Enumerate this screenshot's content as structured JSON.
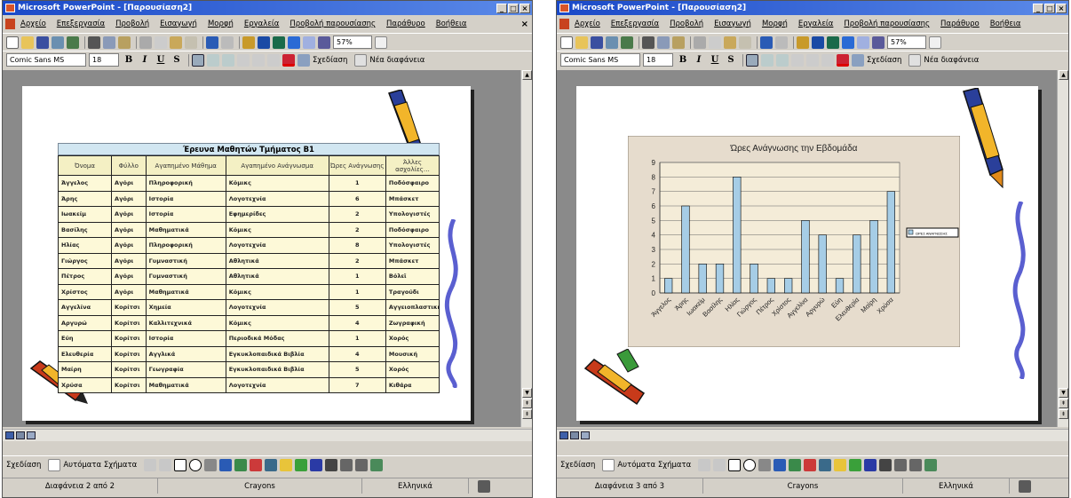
{
  "left": {
    "title": "Microsoft PowerPoint - [Παρουσίαση2]",
    "menu": [
      "Αρχείο",
      "Επεξεργασία",
      "Προβολή",
      "Εισαγωγή",
      "Μορφή",
      "Εργαλεία",
      "Προβολή παρουσίασης",
      "Παράθυρο",
      "Βοήθεια"
    ],
    "zoom": "57%",
    "font": "Comic Sans MS",
    "size": "18",
    "design": "Σχεδίαση",
    "new_slide": "Νέα διαφάνεια",
    "draw": "Σχεδίαση",
    "autoshapes": "Αυτόματα Σχήματα",
    "status_slide": "Διαφάνεια 2 από 2",
    "status_theme": "Crayons",
    "status_lang": "Ελληνικά",
    "table": {
      "title": "Έρευνα Μαθητών Τμήματος Β1",
      "headers": [
        "Όνομα",
        "Φύλλο",
        "Αγαπημένο Μάθημα",
        "Αγαπημένο Ανάγνωσμα",
        "Ώρες Ανάγνωσης",
        "Άλλες ασχολίες…"
      ],
      "rows": [
        [
          "Άγγελος",
          "Αγόρι",
          "Πληροφορική",
          "Κόμικς",
          "1",
          "Ποδόσφαιρο"
        ],
        [
          "Άρης",
          "Αγόρι",
          "Ιστορία",
          "Λογοτεχνία",
          "6",
          "Μπάσκετ"
        ],
        [
          "Ιωακείμ",
          "Αγόρι",
          "Ιστορία",
          "Εφημερίδες",
          "2",
          "Υπολογιστές"
        ],
        [
          "Βασίλης",
          "Αγόρι",
          "Μαθηματικά",
          "Κόμικς",
          "2",
          "Ποδόσφαιρο"
        ],
        [
          "Ηλίας",
          "Αγόρι",
          "Πληροφορική",
          "Λογοτεχνία",
          "8",
          "Υπολογιστές"
        ],
        [
          "Γιώργος",
          "Αγόρι",
          "Γυμναστική",
          "Αθλητικά",
          "2",
          "Μπάσκετ"
        ],
        [
          "Πέτρος",
          "Αγόρι",
          "Γυμναστική",
          "Αθλητικά",
          "1",
          "Βόλεϊ"
        ],
        [
          "Χρίστος",
          "Αγόρι",
          "Μαθηματικά",
          "Κόμικς",
          "1",
          "Τραγούδι"
        ],
        [
          "Αγγελίνα",
          "Κορίτσι",
          "Χημεία",
          "Λογοτεχνία",
          "5",
          "Αγγειοπλαστική"
        ],
        [
          "Αργυρώ",
          "Κορίτσι",
          "Καλλιτεχνικά",
          "Κόμικς",
          "4",
          "Ζωγραφική"
        ],
        [
          "Εύη",
          "Κορίτσι",
          "Ιστορία",
          "Περιοδικά Μόδας",
          "1",
          "Χορός"
        ],
        [
          "Ελευθερία",
          "Κορίτσι",
          "Αγγλικά",
          "Εγκυκλοπαιδικά Βιβλία",
          "4",
          "Μουσική"
        ],
        [
          "Μαίρη",
          "Κορίτσι",
          "Γεωγραφία",
          "Εγκυκλοπαιδικά Βιβλία",
          "5",
          "Χορός"
        ],
        [
          "Χρύσα",
          "Κορίτσι",
          "Μαθηματικά",
          "Λογοτεχνία",
          "7",
          "Κιθάρα"
        ]
      ]
    }
  },
  "right": {
    "title": "Microsoft PowerPoint - [Παρουσίαση2]",
    "menu": [
      "Αρχείο",
      "Επεξεργασία",
      "Προβολή",
      "Εισαγωγή",
      "Μορφή",
      "Εργαλεία",
      "Προβολή παρουσίασης",
      "Παράθυρο",
      "Βοήθεια"
    ],
    "zoom": "57%",
    "font": "Comic Sans MS",
    "size": "18",
    "design": "Σχεδίαση",
    "new_slide": "Νέα διαφάνεια",
    "draw": "Σχεδίαση",
    "autoshapes": "Αυτόματα Σχήματα",
    "status_slide": "Διαφάνεια 3 από 3",
    "status_theme": "Crayons",
    "status_lang": "Ελληνικά"
  },
  "chart_data": {
    "type": "bar",
    "title": "Ώρες Ανάγνωσης την Εβδομάδα",
    "categories": [
      "Άγγελος",
      "Άρης",
      "Ιωακείμ",
      "Βασίλης",
      "Ηλίας",
      "Γιώργος",
      "Πέτρος",
      "Χρίστος",
      "Αγγελίνα",
      "Αργυρώ",
      "Εύη",
      "Ελευθερία",
      "Μαίρη",
      "Χρύσα"
    ],
    "series": [
      {
        "name": "ΩΡΕΣ ΑΝΑΓΝΩΣΗΣ",
        "values": [
          1,
          6,
          2,
          2,
          8,
          2,
          1,
          1,
          5,
          4,
          1,
          4,
          5,
          7
        ]
      }
    ],
    "ylim": [
      0,
      9
    ],
    "yticks": [
      0,
      1,
      2,
      3,
      4,
      5,
      6,
      7,
      8,
      9
    ],
    "bar_color": "#a6cde6",
    "legend": "right",
    "grid": true
  }
}
